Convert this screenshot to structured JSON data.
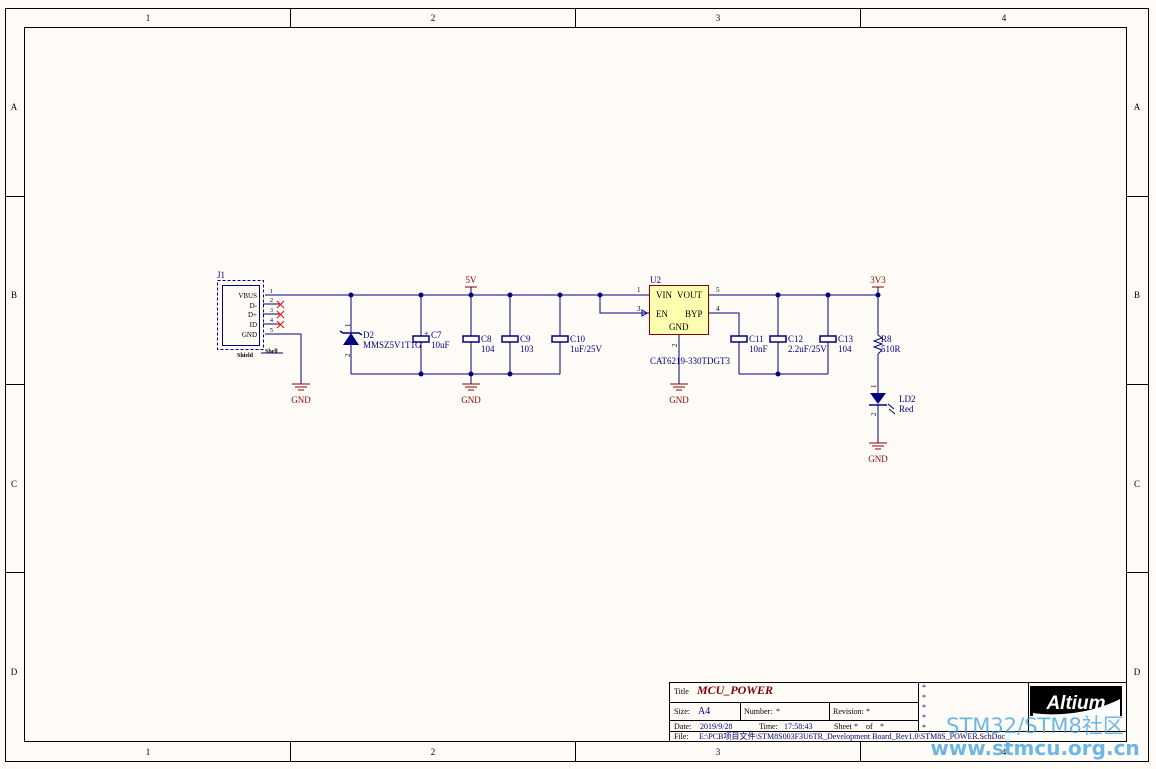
{
  "frame": {
    "columns": [
      "1",
      "2",
      "3",
      "4"
    ],
    "rows": [
      "A",
      "B",
      "C",
      "D"
    ]
  },
  "nets": {
    "v5": "5V",
    "v33": "3V3",
    "gnd": "GND"
  },
  "j1": {
    "ref": "J1",
    "pins": [
      {
        "num": "1",
        "name": "VBUS"
      },
      {
        "num": "2",
        "name": "D-"
      },
      {
        "num": "3",
        "name": "D+"
      },
      {
        "num": "4",
        "name": "ID"
      },
      {
        "num": "5",
        "name": "GND"
      }
    ],
    "shield": "Shield",
    "shell": "Shell"
  },
  "d2": {
    "ref": "D2",
    "value": "MMSZ5V1T1G",
    "pin1": "1",
    "pin2": "2"
  },
  "caps_in": [
    {
      "ref": "C7",
      "value": "10uF",
      "polar": "+"
    },
    {
      "ref": "C8",
      "value": "104"
    },
    {
      "ref": "C9",
      "value": "103"
    },
    {
      "ref": "C10",
      "value": "1uF/25V"
    }
  ],
  "u2": {
    "ref": "U2",
    "part": "CAT6219-330TDGT3",
    "pins": {
      "vin": "VIN",
      "vout": "VOUT",
      "en": "EN",
      "byp": "BYP",
      "gnd": "GND"
    },
    "pin_numbers": {
      "vin": "1",
      "en": "3",
      "gnd": "2",
      "vout": "5",
      "byp": "4"
    }
  },
  "caps_out": [
    {
      "ref": "C11",
      "value": "10nF"
    },
    {
      "ref": "C12",
      "value": "2.2uF/25V"
    },
    {
      "ref": "C13",
      "value": "104"
    }
  ],
  "r8": {
    "ref": "R8",
    "value": "510R"
  },
  "ld2": {
    "ref": "LD2",
    "value": "Red",
    "pin1": "1",
    "pin2": "2"
  },
  "title_block": {
    "title_label": "Title",
    "title": "MCU_POWER",
    "size_label": "Size:",
    "size": "A4",
    "number_label": "Number:",
    "number": "*",
    "revision_label": "Revision:",
    "revision": "*",
    "date_label": "Date:",
    "date": "2019/9/28",
    "time_label": "Time:",
    "time": "17:58:43",
    "sheet_label": "Sheet",
    "sheet": "*",
    "of_label": "of",
    "of": "*",
    "file_label": "File:",
    "file": "E:\\PCB项目文件\\STM8S003F3U6TR_Development Board_Rev1.0\\STM8S_POWER.SchDoc",
    "stars": [
      "*",
      "*",
      "*",
      "*",
      "*"
    ],
    "logo": "Altium"
  },
  "watermark": {
    "line1": "STM32/STM8社区",
    "line2": "www.stmcu.org.cn"
  },
  "colors": {
    "wire": "#000080",
    "frame": "#000000",
    "net_label": "#800000",
    "power": "#8b0000",
    "component_fill": "#ffffb0",
    "no_connect": "#ff0000",
    "background": "#fffcf8",
    "watermark": "#3aa0e0"
  }
}
